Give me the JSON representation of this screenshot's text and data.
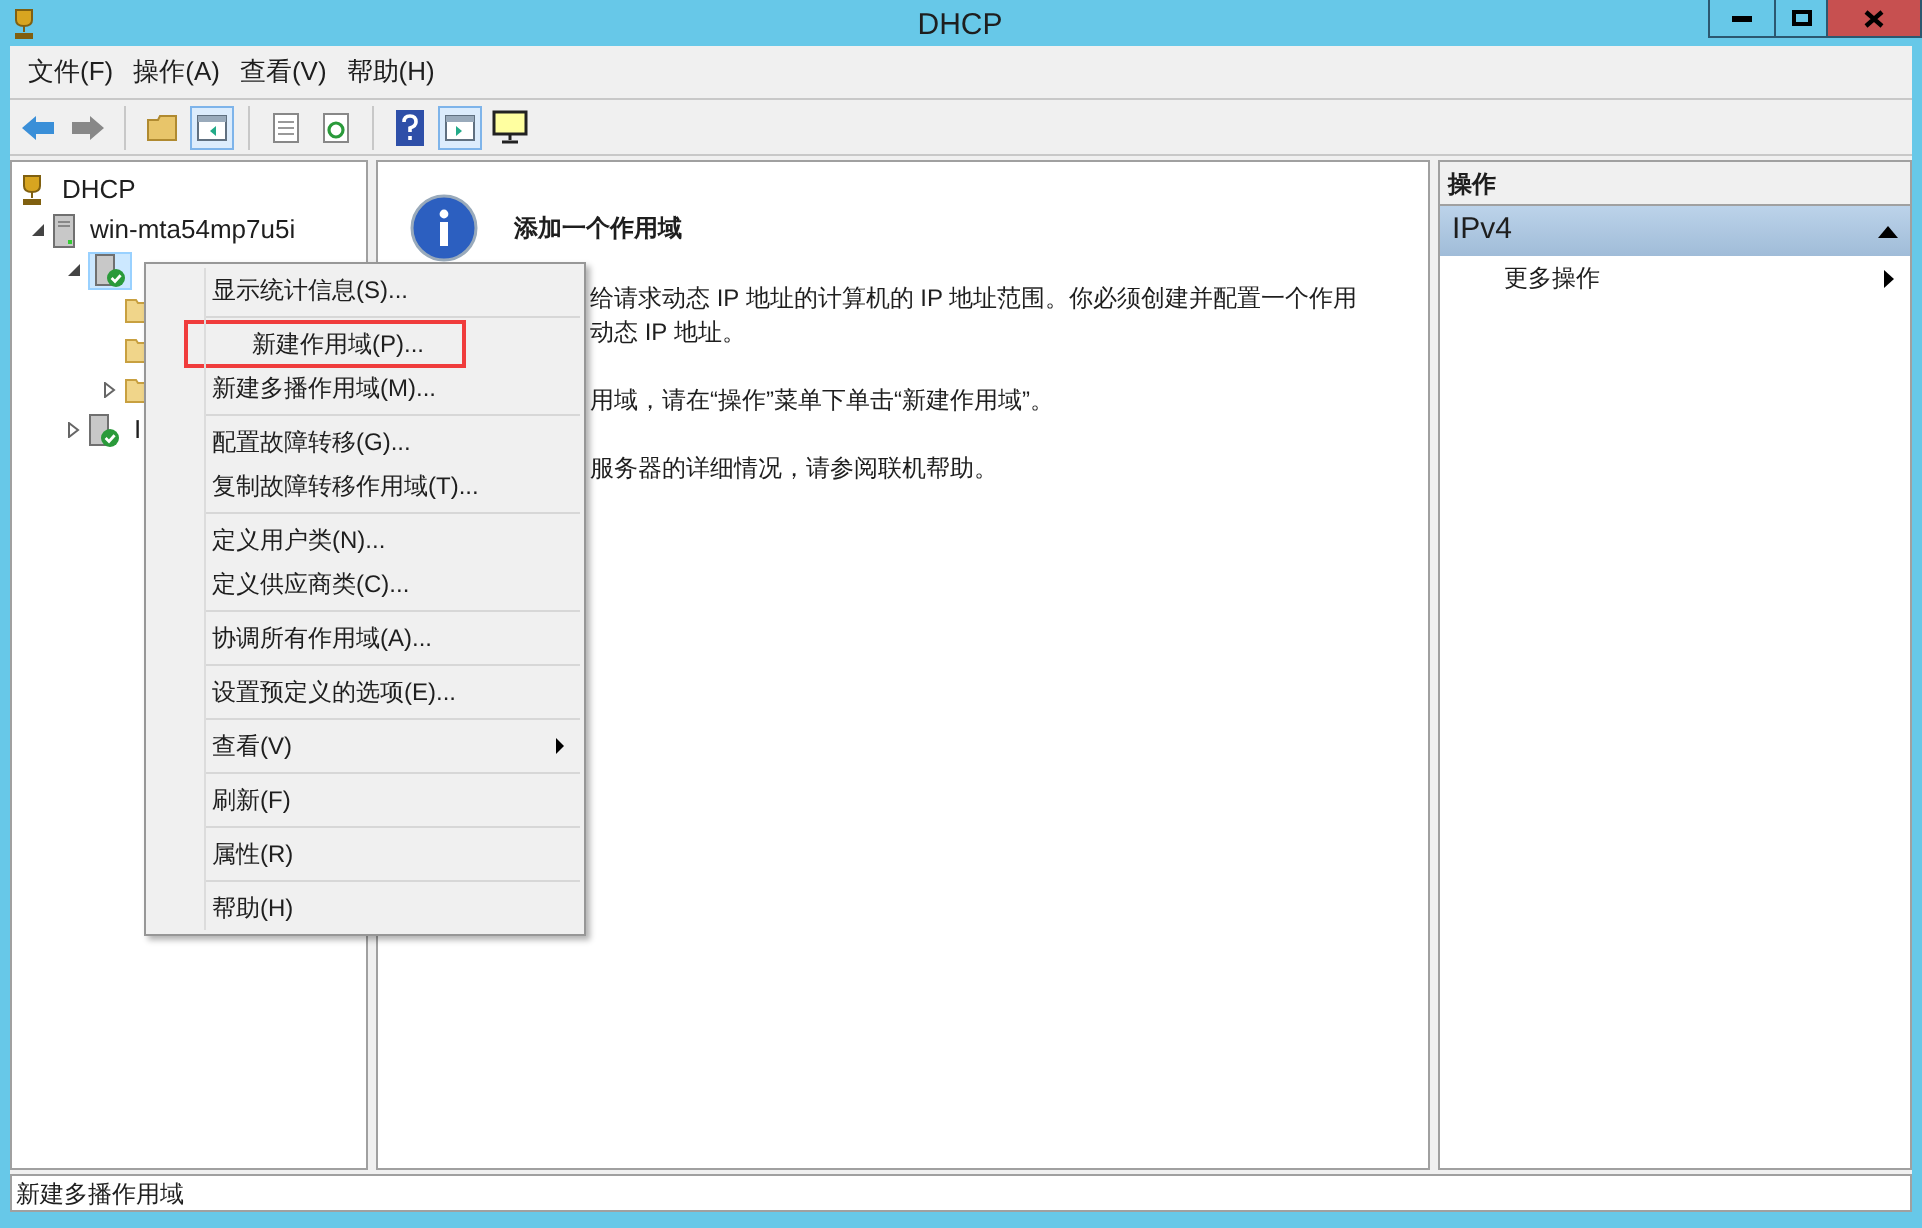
{
  "window": {
    "title": "DHCP"
  },
  "menu_bar": [
    "文件(F)",
    "操作(A)",
    "查看(V)",
    "帮助(H)"
  ],
  "toolbar": [
    {
      "kind": "back"
    },
    {
      "kind": "forward"
    },
    {
      "kind": "sep"
    },
    {
      "kind": "folder"
    },
    {
      "kind": "pane",
      "selected": true
    },
    {
      "kind": "sep"
    },
    {
      "kind": "list"
    },
    {
      "kind": "refresh"
    },
    {
      "kind": "sep"
    },
    {
      "kind": "help"
    },
    {
      "kind": "pane2",
      "selected": true
    },
    {
      "kind": "monitor"
    }
  ],
  "tree": [
    {
      "label": "DHCP",
      "kind": "root",
      "children": [
        {
          "label": "win-mta54mp7u5i",
          "kind": "server",
          "expanded": true,
          "children": [
            {
              "kind": "ipv",
              "expanded": true,
              "selected": true,
              "children": [
                {
                  "kind": "folder"
                },
                {
                  "kind": "folder"
                },
                {
                  "kind": "folder",
                  "expanded": false
                }
              ]
            },
            {
              "label": "I",
              "kind": "ipv",
              "expanded": false,
              "selected": false
            }
          ]
        }
      ]
    }
  ],
  "content": {
    "heading": "添加一个作用域",
    "paragraphs": [
      [
        "给请求动态 IP 地址的计算机的 IP 地址范围。你必须创建并配置一个作用",
        "动态 IP 地址。"
      ],
      [
        "用域，请在“操作”菜单下单击“新建作用域”。"
      ],
      [
        "服务器的详细情况，请参阅联机帮助。"
      ]
    ]
  },
  "actions": {
    "title": "操作",
    "section": "IPv4",
    "items": [
      {
        "label": "更多操作",
        "submenu": true
      }
    ]
  },
  "context_menu": [
    [
      {
        "label": "显示统计信息(S)...",
        "highlighted": false
      }
    ],
    [
      {
        "label": "新建作用域(P)...",
        "highlighted": true
      },
      {
        "label": "新建多播作用域(M)...",
        "highlighted": false
      }
    ],
    [
      {
        "label": "配置故障转移(G)...",
        "highlighted": false
      },
      {
        "label": "复制故障转移作用域(T)...",
        "highlighted": false
      }
    ],
    [
      {
        "label": "定义用户类(N)...",
        "highlighted": false
      },
      {
        "label": "定义供应商类(C)...",
        "highlighted": false
      }
    ],
    [
      {
        "label": "协调所有作用域(A)...",
        "highlighted": false
      }
    ],
    [
      {
        "label": "设置预定义的选项(E)...",
        "highlighted": false
      }
    ],
    [
      {
        "label": "查看(V)",
        "highlighted": false,
        "submenu": true
      }
    ],
    [
      {
        "label": "刷新(F)",
        "highlighted": false
      }
    ],
    [
      {
        "label": "属性(R)",
        "highlighted": false
      }
    ],
    [
      {
        "label": "帮助(H)",
        "highlighted": false
      }
    ]
  ],
  "status_bar": "新建多播作用域"
}
